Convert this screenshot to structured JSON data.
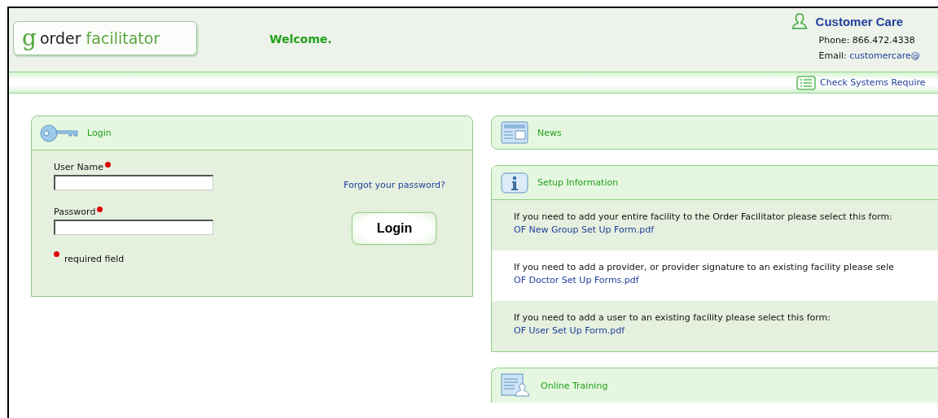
{
  "header": {
    "logo_mark": "g",
    "logo_word1": "order",
    "logo_word2": "facilitator",
    "welcome": "Welcome.",
    "customer_care": {
      "title": "Customer Care",
      "phone_label": "Phone:",
      "phone": "866.472.4338",
      "email_label": "Email:",
      "email": "customercare@"
    },
    "systems_link": "Check Systems Require"
  },
  "login": {
    "title": "Login",
    "fields": [
      {
        "label": "User Name",
        "required": true
      },
      {
        "label": "Password",
        "required": true
      }
    ],
    "forgot_link": "Forgot your password?",
    "button": "Login",
    "required_note": "required field"
  },
  "news": {
    "title": "News"
  },
  "setup": {
    "title": "Setup Information",
    "rows": [
      {
        "text": "If you need to add your entire facility to the Order Facilitator please select this form:",
        "link": "OF New Group Set Up Form.pdf"
      },
      {
        "text": "If you need to add a provider, or provider signature to an existing facility please sele",
        "link": "OF Doctor Set Up Forms.pdf"
      },
      {
        "text": "If you need to add a user to an existing facility please select this form:",
        "link": "OF User Set Up Form.pdf"
      }
    ]
  },
  "training": {
    "title": "Online Training"
  }
}
